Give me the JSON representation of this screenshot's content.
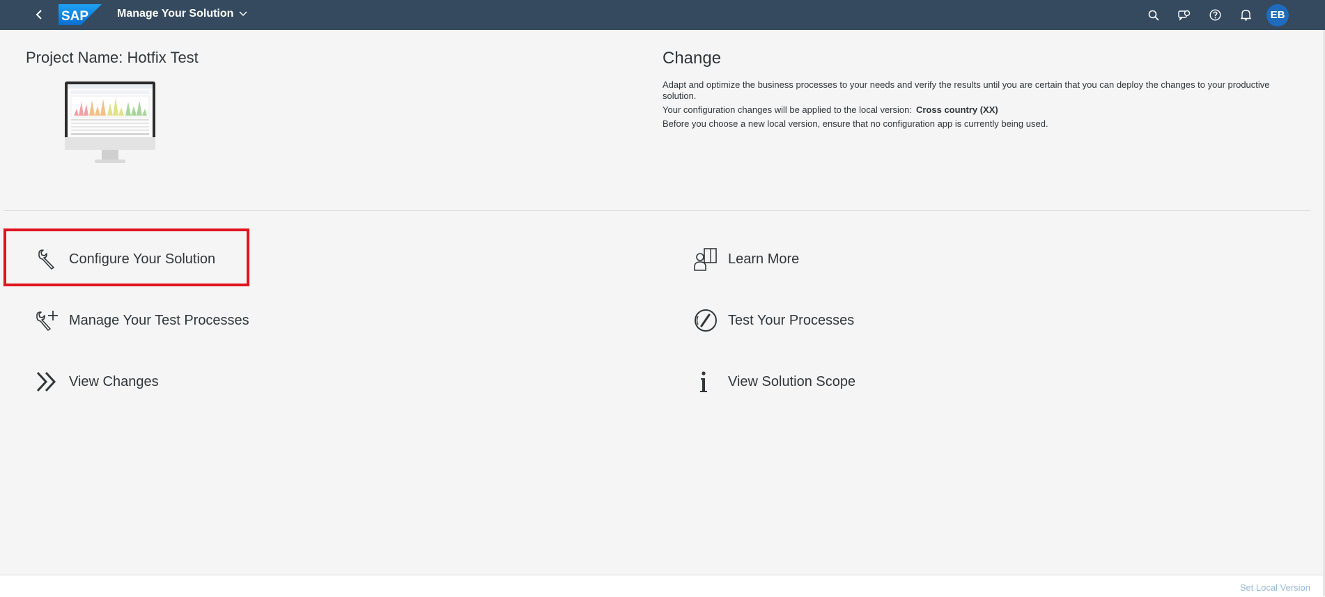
{
  "shell": {
    "logo_text": "SAP",
    "app_title": "Manage Your Solution",
    "avatar_initials": "EB",
    "colors": {
      "shell_bg": "#354a5f",
      "avatar_bg": "#1f6bbd",
      "logo_blue": "#0a6ed1"
    },
    "icons": [
      "back-icon",
      "search-icon",
      "feedback-icon",
      "help-icon",
      "notification-bell-icon",
      "user-avatar"
    ]
  },
  "project": {
    "name_label": "Project Name: Hotfix Test"
  },
  "change": {
    "title": "Change",
    "desc_line1": "Adapt and optimize the business processes to your needs and verify the results until you are certain that you can deploy the changes to your productive solution.",
    "desc_line2_prefix": "Your configuration changes will be applied to the local version:",
    "local_version": "Cross country (XX)",
    "desc_line3": "Before you choose a new local version, ensure that no configuration app is currently being used."
  },
  "tiles": {
    "configure": {
      "label": "Configure Your Solution",
      "icon": "wrench-icon"
    },
    "manage_tests": {
      "label": "Manage Your Test Processes",
      "icon": "wrench-add-icon"
    },
    "view_changes": {
      "label": "View Changes",
      "icon": "double-chevron-icon"
    },
    "learn_more": {
      "label": "Learn More",
      "icon": "learn-person-icon"
    },
    "test_processes": {
      "label": "Test Your Processes",
      "icon": "gauge-icon"
    },
    "view_scope": {
      "label": "View Solution Scope",
      "icon": "info-icon"
    }
  },
  "footer": {
    "set_local_version": "Set Local Version"
  },
  "highlight_color": "#e0141e"
}
